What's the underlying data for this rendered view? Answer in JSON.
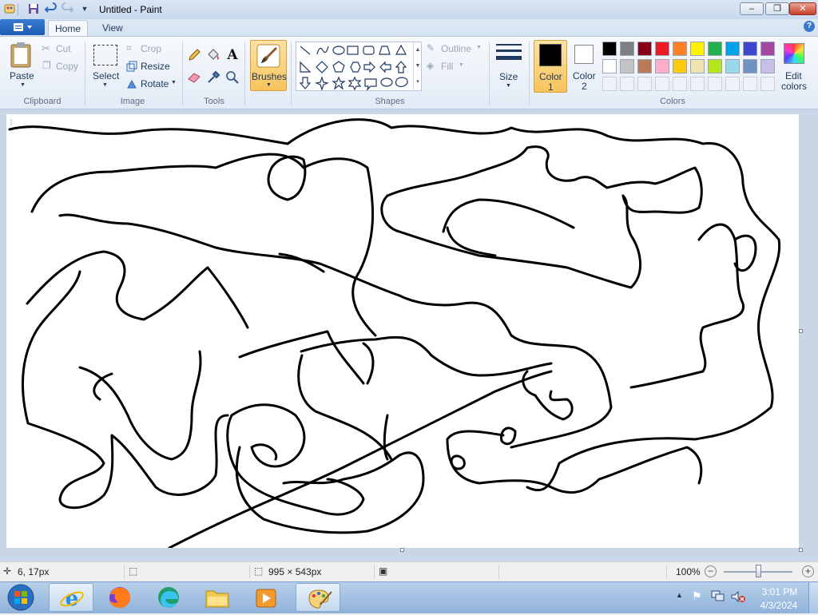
{
  "window": {
    "title": "Untitled - Paint"
  },
  "tabs": {
    "home": "Home",
    "view": "View"
  },
  "clipboard": {
    "paste": "Paste",
    "cut": "Cut",
    "copy": "Copy",
    "label": "Clipboard"
  },
  "image": {
    "select": "Select",
    "crop": "Crop",
    "resize": "Resize",
    "rotate": "Rotate",
    "label": "Image"
  },
  "tools": {
    "label": "Tools"
  },
  "brushes": {
    "label": "Brushes"
  },
  "shapes": {
    "outline": "Outline",
    "fill": "Fill",
    "label": "Shapes"
  },
  "size": {
    "label": "Size"
  },
  "color1": {
    "label_line1": "Color",
    "label_line2": "1",
    "value": "#000000"
  },
  "color2": {
    "label_line1": "Color",
    "label_line2": "2",
    "value": "#ffffff"
  },
  "colors": {
    "label": "Colors",
    "edit_line1": "Edit",
    "edit_line2": "colors",
    "row1": [
      "#000000",
      "#7f7f7f",
      "#880015",
      "#ed1c24",
      "#ff7f27",
      "#fff200",
      "#22b14c",
      "#00a2e8",
      "#3f48cc",
      "#a349a4"
    ],
    "row2": [
      "#ffffff",
      "#c3c3c3",
      "#b97a57",
      "#ffaec9",
      "#ffc90e",
      "#efe4b0",
      "#b5e61d",
      "#99d9ea",
      "#7092be",
      "#c8bfe7"
    ]
  },
  "status": {
    "cursor_pos": "6, 17px",
    "canvas_size": "995 × 543px",
    "zoom": "100%"
  },
  "taskbar": {
    "time": "3:01 PM",
    "date": "4/3/2024"
  }
}
